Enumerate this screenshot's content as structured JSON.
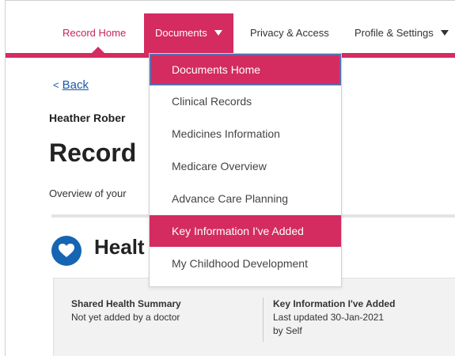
{
  "nav": {
    "items": [
      {
        "label": "Record Home"
      },
      {
        "label": "Documents"
      },
      {
        "label": "Privacy & Access"
      },
      {
        "label": "Profile & Settings"
      }
    ],
    "active_color": "#c8245a",
    "brand_color": "#d42b61"
  },
  "dropdown": {
    "items": [
      {
        "label": "Documents Home"
      },
      {
        "label": "Clinical Records"
      },
      {
        "label": "Medicines Information"
      },
      {
        "label": "Medicare Overview"
      },
      {
        "label": "Advance Care Planning"
      },
      {
        "label": "Key Information I've Added"
      },
      {
        "label": "My Childhood Development"
      }
    ]
  },
  "page": {
    "back_label": "Back",
    "patient_name": "Heather Rober",
    "title": "Record",
    "overview": "Overview of your",
    "health_title": "Healt"
  },
  "summary": {
    "col1": {
      "heading": "Shared Health Summary",
      "text": "Not yet added by a doctor"
    },
    "col2": {
      "heading": "Key Information I've Added",
      "line1": "Last updated 30-Jan-2021",
      "line2": "by Self"
    }
  }
}
